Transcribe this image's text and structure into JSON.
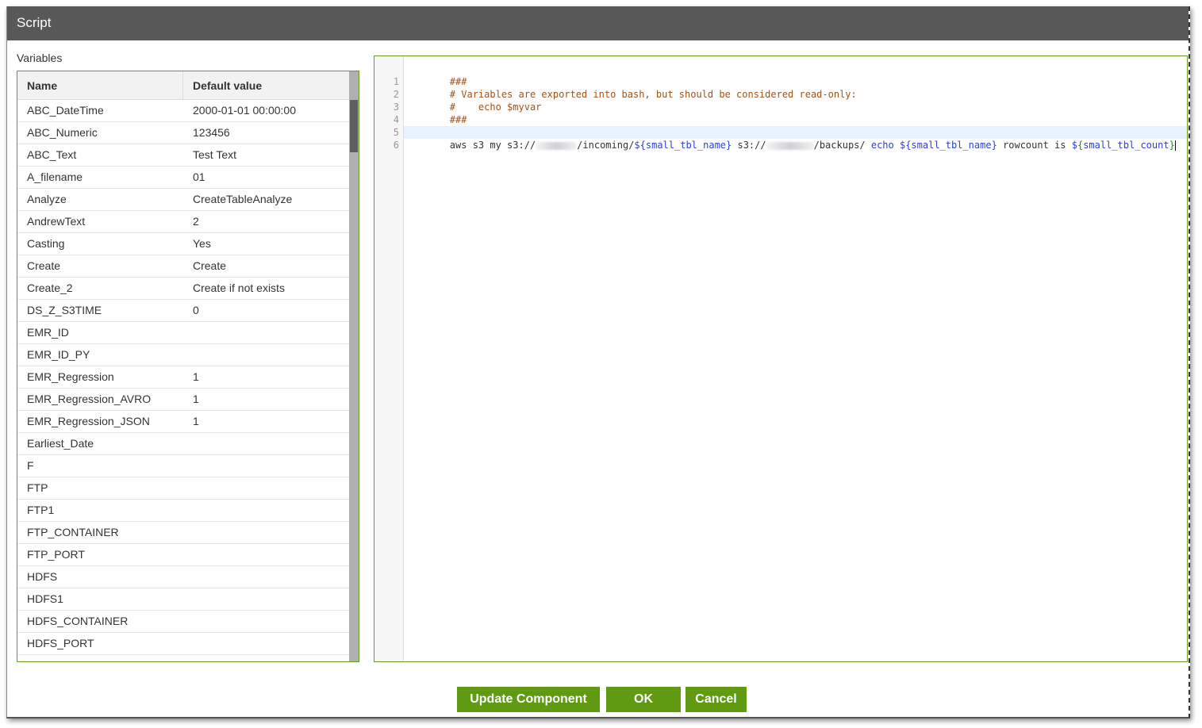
{
  "window": {
    "title": "Script"
  },
  "variables": {
    "label": "Variables",
    "columns": {
      "name": "Name",
      "default_value": "Default value"
    },
    "rows": [
      {
        "name": "ABC_DateTime",
        "value": "2000-01-01 00:00:00"
      },
      {
        "name": "ABC_Numeric",
        "value": "123456"
      },
      {
        "name": "ABC_Text",
        "value": "Test Text"
      },
      {
        "name": "A_filename",
        "value": "01"
      },
      {
        "name": "Analyze",
        "value": "CreateTableAnalyze"
      },
      {
        "name": "AndrewText",
        "value": "2"
      },
      {
        "name": "Casting",
        "value": "Yes"
      },
      {
        "name": "Create",
        "value": "Create"
      },
      {
        "name": "Create_2",
        "value": "Create if not exists"
      },
      {
        "name": "DS_Z_S3TIME",
        "value": "0"
      },
      {
        "name": "EMR_ID",
        "value": ""
      },
      {
        "name": "EMR_ID_PY",
        "value": ""
      },
      {
        "name": "EMR_Regression",
        "value": "1"
      },
      {
        "name": "EMR_Regression_AVRO",
        "value": "1"
      },
      {
        "name": "EMR_Regression_JSON",
        "value": "1"
      },
      {
        "name": "Earliest_Date",
        "value": ""
      },
      {
        "name": "F",
        "value": ""
      },
      {
        "name": "FTP",
        "value": ""
      },
      {
        "name": "FTP1",
        "value": ""
      },
      {
        "name": "FTP_CONTAINER",
        "value": ""
      },
      {
        "name": "FTP_PORT",
        "value": ""
      },
      {
        "name": "HDFS",
        "value": ""
      },
      {
        "name": "HDFS1",
        "value": ""
      },
      {
        "name": "HDFS_CONTAINER",
        "value": ""
      },
      {
        "name": "HDFS_PORT",
        "value": ""
      }
    ]
  },
  "editor": {
    "line_numbers": [
      "1",
      "2",
      "3",
      "4",
      "5",
      "6"
    ],
    "lines": {
      "l1": "###",
      "l2": "# Variables are exported into bash, but should be considered read-only:",
      "l3": "#    echo $myvar",
      "l4": "###",
      "l6": {
        "a": "aws s3 my s3://",
        "b": "/incoming/",
        "c": "${small_tbl_name}",
        "d": " s3://",
        "e": "/backups/ ",
        "f": "echo ",
        "g": "${small_tbl_name}",
        "h": " rowcount is ",
        "i": "$",
        "j": "{",
        "k": "small_tbl_count",
        "l": "}"
      }
    }
  },
  "buttons": {
    "update": "Update Component",
    "ok": "OK",
    "cancel": "Cancel"
  },
  "colors": {
    "accent": "#5f9a12",
    "title_bar": "#585858",
    "comment": "#a0521c",
    "variable": "#2f3fcc"
  }
}
